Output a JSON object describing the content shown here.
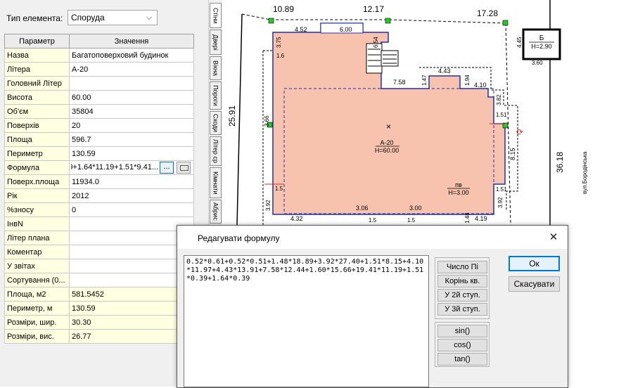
{
  "element_type": {
    "label": "Тип елемента:",
    "value": "Споруда"
  },
  "table": {
    "headers": [
      "Параметр",
      "Значення"
    ],
    "rows": [
      {
        "name": "Назва",
        "value": "Багатоповерховий будинок"
      },
      {
        "name": "Літера",
        "value": "А-20"
      },
      {
        "name": "Головний Літер",
        "value": ""
      },
      {
        "name": "Висота",
        "value": "60.00"
      },
      {
        "name": "Об'єм",
        "value": "35804"
      },
      {
        "name": "Поверхів",
        "value": "20"
      },
      {
        "name": "Площа",
        "value": "596.7"
      },
      {
        "name": "Периметр",
        "value": "130.59"
      },
      {
        "name": "Формула",
        "value": "...9.41*11.19+1.51*0.39+1.64*0.39"
      },
      {
        "name": "Поверх.площа",
        "value": "11934.0"
      },
      {
        "name": "Рік",
        "value": "2012"
      },
      {
        "name": "%зносу",
        "value": "0"
      },
      {
        "name": "ІнвN",
        "value": ""
      },
      {
        "name": "Літер плана",
        "value": ""
      },
      {
        "name": "Коментар",
        "value": ""
      },
      {
        "name": "У звітах",
        "value": ""
      },
      {
        "name": "Сортування (0...",
        "value": ""
      },
      {
        "name": "Площа, м2",
        "value": "581.5452"
      },
      {
        "name": "Периметр, м",
        "value": "130.59"
      },
      {
        "name": "Розміри, шир.",
        "value": "30.30"
      },
      {
        "name": "Розміри, вис.",
        "value": "26.77"
      }
    ],
    "formula_button": "..."
  },
  "tabs": [
    "Стіни",
    "Двері",
    "Вікна",
    "Пороги",
    "Сходи",
    "Літер ср",
    "Кімнати",
    "Абрис"
  ],
  "drawing": {
    "dims": {
      "d1089": "10.89",
      "d1217": "12.17",
      "d1728": "17.28",
      "d452": "4.52",
      "d600": "6.00",
      "d375": "3.75",
      "d16": "1.6",
      "d654": "6.54",
      "d758": "7.58",
      "d147": "1.47",
      "d443": "4.43",
      "d194": "1.94",
      "d410": "4.10",
      "d382": "3.82",
      "d151a": "1.51",
      "d815": "8.15",
      "d151b": "1.51",
      "d392a": "3.92",
      "d15a": "1.5",
      "d392b": "3.92",
      "d306": "3.06",
      "d300": "3.00",
      "d432": "4.32",
      "d15b": "1.5",
      "d15c": "1.5",
      "d148": "1.48",
      "d419": "4.19",
      "d366": "3.66",
      "d2591": "25.91",
      "d3618": "36.18",
      "d445": "4.45",
      "d360": "3.60"
    },
    "building_label": "А-20",
    "building_height": "Н=60.00",
    "sub_label": "пв",
    "sub_height": "Н=3.00",
    "small_label": "Б",
    "small_height": "Н=2.90",
    "street": "вул.Бородінська"
  },
  "dialog": {
    "title": "Редагувати формулу",
    "formula": "0.52*0.61+0.52*0.51+1.48*18.89+3.92*27.40+1.51*8.15+4.10*11.97+4.43*13.91+7.58*12.44+1.60*15.66+19.41*11.19+1.51*0.39+1.64*0.39",
    "buttons_math": [
      "Число Пі",
      "Корінь кв.",
      "У 2й ступ.",
      "У 3й ступ."
    ],
    "buttons_trig": [
      "sin()",
      "cos()",
      "tan()"
    ],
    "ok": "Ок",
    "cancel": "Скасувати",
    "close": "✕"
  },
  "colors": {
    "building_fill": "#f7c3ae",
    "accent": "#0078d7",
    "marker": "#22cc22",
    "wall": "#1f2fb0"
  }
}
